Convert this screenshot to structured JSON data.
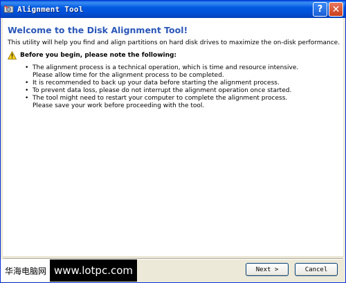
{
  "window": {
    "title": "Alignment Tool",
    "help_label": "?",
    "close_label": "✕"
  },
  "content": {
    "heading": "Welcome to the Disk Alignment Tool!",
    "intro": "This utility will help you find and align partitions on hard disk drives to maximize the on-disk performance.",
    "warning_title": "Before you begin, please note the following:",
    "bullets": [
      {
        "line1": "The alignment process is a technical operation, which is time and resource intensive.",
        "line2": "Please allow time for the alignment process to be completed."
      },
      {
        "line1": "It is recommended to back up your data before starting the alignment process.",
        "line2": ""
      },
      {
        "line1": "To prevent data loss, please do not interrupt the alignment operation once started.",
        "line2": ""
      },
      {
        "line1": "The tool might need to restart your computer to complete the alignment process.",
        "line2": "Please save your work before proceeding with the tool."
      }
    ]
  },
  "footer": {
    "next_label": "Next >",
    "cancel_label": "Cancel",
    "watermark_cn": "华海电脑网",
    "watermark_url": "www.lotpc.com"
  },
  "icons": {
    "app": "disk-tool-icon",
    "warning": "warning-icon",
    "help": "help-icon",
    "close": "close-icon"
  },
  "colors": {
    "titlebar": "#0058e0",
    "heading": "#2a57b8",
    "window_bg": "#ece9d8"
  }
}
